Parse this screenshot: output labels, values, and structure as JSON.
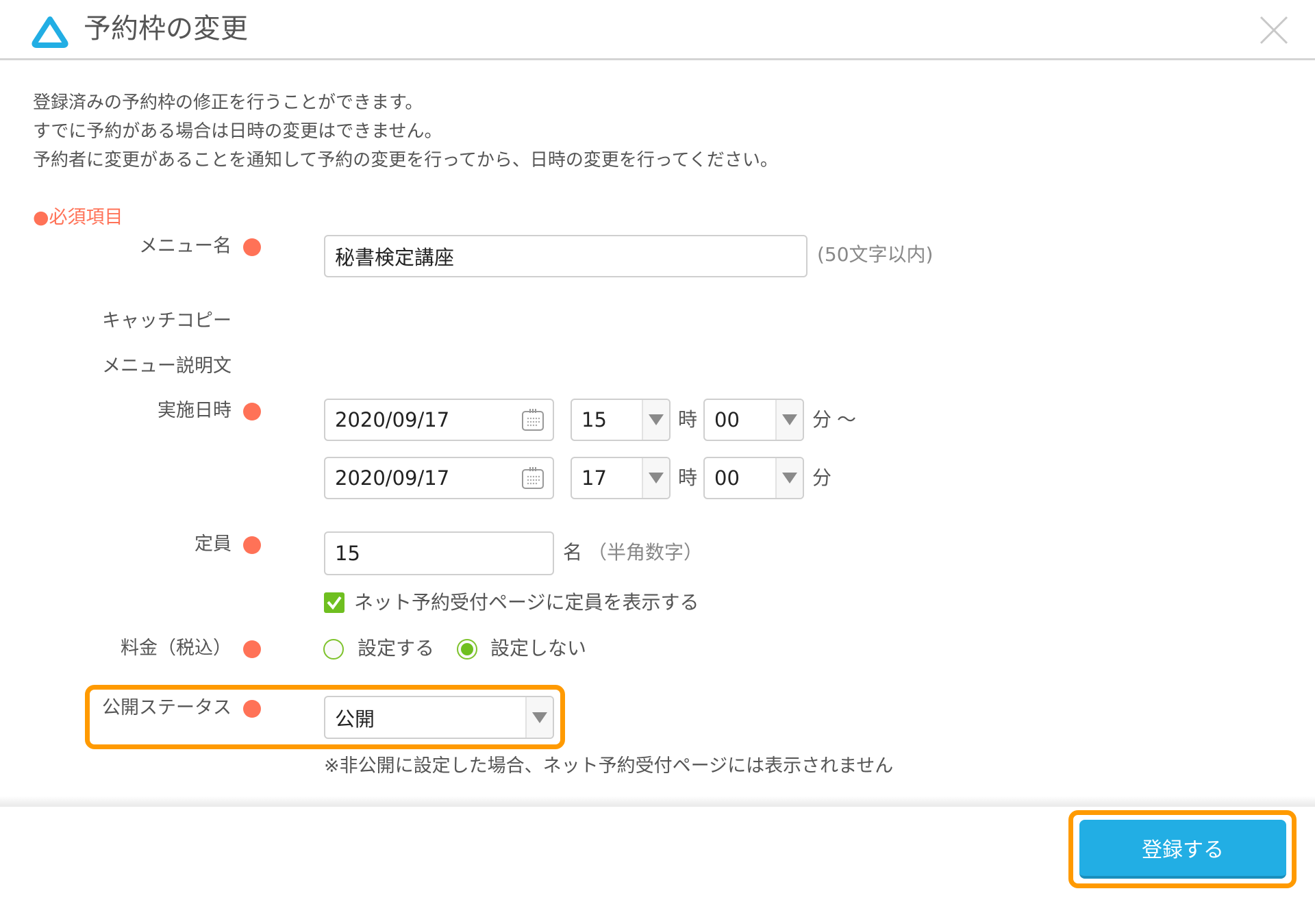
{
  "header": {
    "title": "予約枠の変更",
    "logo_icon": "triangle-logo-icon",
    "close_icon": "close-icon"
  },
  "description": [
    "登録済みの予約枠の修正を行うことができます。",
    "すでに予約がある場合は日時の変更はできません。",
    "予約者に変更があることを通知して予約の変更を行ってから、日時の変更を行ってください。"
  ],
  "required_note": "●必須項目",
  "colors": {
    "required_dot": "#ff7257",
    "accent_blue": "#22aee4",
    "check_green": "#6fbf20",
    "highlight_orange": "#ff9a00"
  },
  "form": {
    "menu_name": {
      "label": "メニュー名",
      "value": "秘書検定講座",
      "hint": "(50文字以内)",
      "required": true
    },
    "catch_copy": {
      "label": "キャッチコピー"
    },
    "menu_description": {
      "label": "メニュー説明文"
    },
    "datetime": {
      "label": "実施日時",
      "required": true,
      "start": {
        "date": "2020/09/17",
        "hour": "15",
        "minute": "00"
      },
      "end": {
        "date": "2020/09/17",
        "hour": "17",
        "minute": "00"
      },
      "hour_unit": "時",
      "minute_unit": "分",
      "range_sep": "～"
    },
    "capacity": {
      "label": "定員",
      "required": true,
      "value": "15",
      "unit": "名",
      "hint": "（半角数字）",
      "show_capacity_checkbox": {
        "label": "ネット予約受付ページに定員を表示する",
        "checked": true
      }
    },
    "fee": {
      "label": "料金（税込）",
      "required": true,
      "options": [
        {
          "label": "設定する",
          "selected": false
        },
        {
          "label": "設定しない",
          "selected": true
        }
      ]
    },
    "publish_status": {
      "label": "公開ステータス",
      "required": true,
      "value": "公開",
      "note": "※非公開に設定した場合、ネット予約受付ページには表示されません"
    }
  },
  "footer": {
    "submit_label": "登録する"
  }
}
